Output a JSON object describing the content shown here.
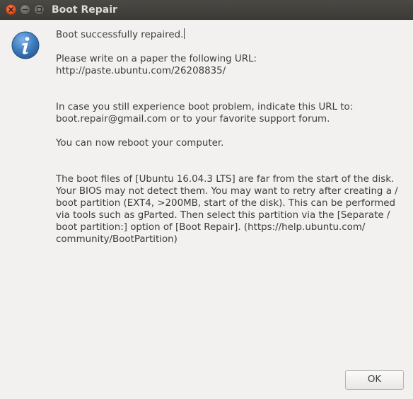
{
  "window": {
    "title": "Boot Repair"
  },
  "dialog": {
    "icon": "info-icon",
    "accent_color": "#3f7cbf",
    "line_success": "Boot successfully repaired.",
    "line_write_url": "Please write on a paper the following URL:\nhttp://paste.ubuntu.com/26208835/",
    "line_still_problem": "In case you still experience boot problem, indicate this URL to:\nboot.repair@gmail.com or to your favorite support forum.",
    "line_reboot": "You can now reboot your computer.",
    "line_boot_files": "The boot files of [Ubuntu 16.04.3 LTS] are far from the start of the disk.\nYour BIOS may not detect them. You may want to retry after creating a /\nboot partition (EXT4, >200MB, start of the disk). This can be performed\nvia tools such as gParted. Then select this partition via the [Separate /\nboot partition:] option of [Boot Repair]. (https://help.ubuntu.com/\ncommunity/BootPartition)"
  },
  "buttons": {
    "ok_label": "OK"
  }
}
